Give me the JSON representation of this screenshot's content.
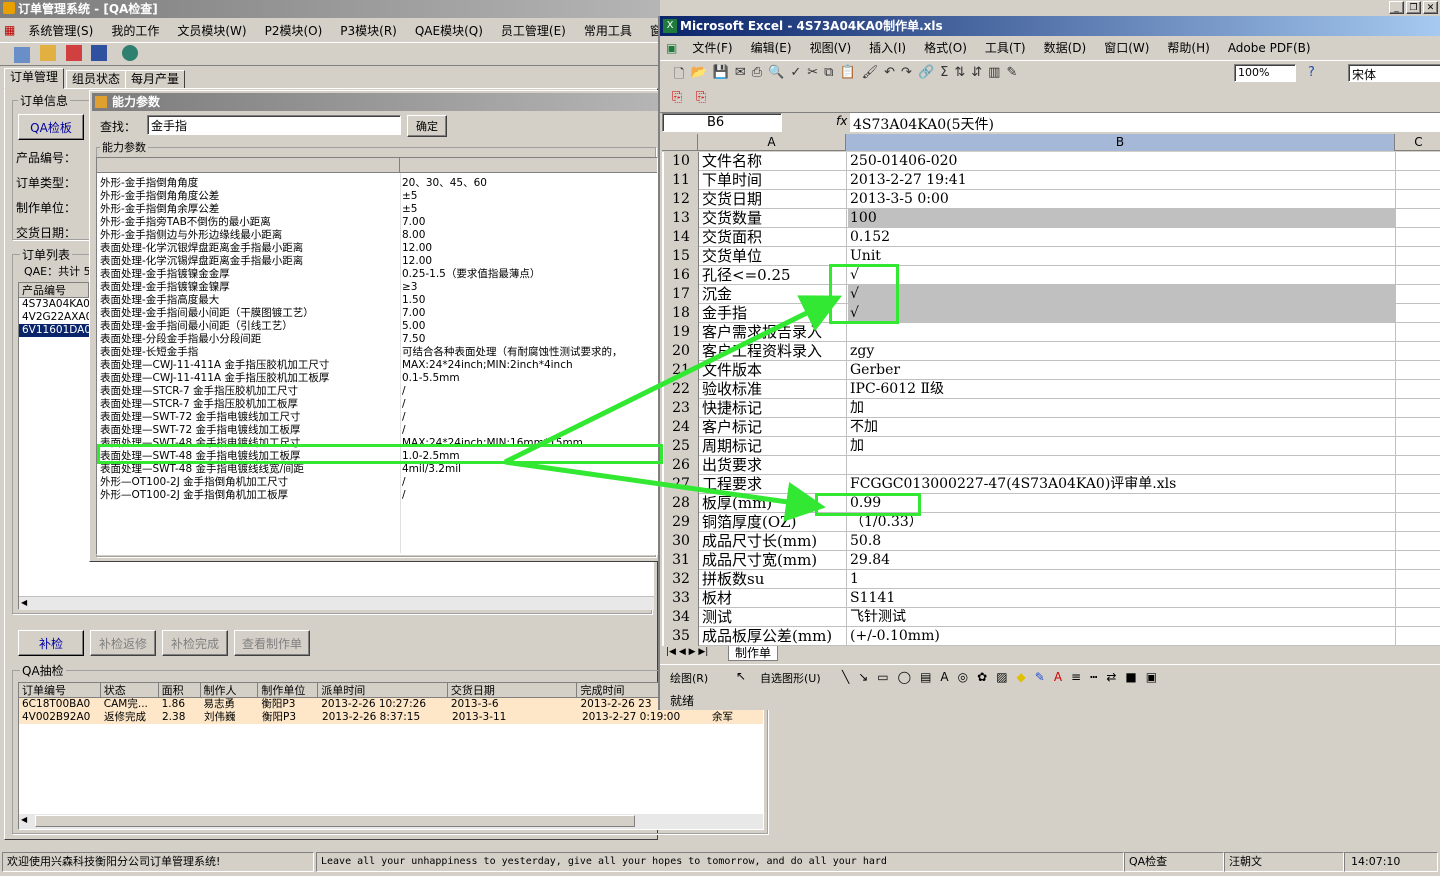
{
  "app": {
    "title": "订单管理系统 - [QA检查]",
    "menu": [
      "系统管理(S)",
      "我的工作",
      "文员模块(W)",
      "P2模块(O)",
      "P3模块(R)",
      "QAE模块(Q)",
      "员工管理(E)",
      "常用工具",
      "窗"
    ],
    "tabs": [
      "订单管理",
      "组员状态",
      "每月产量"
    ],
    "order_info": {
      "legend": "订单信息",
      "qa_button": "QA检板",
      "labels": [
        "产品编号：",
        "订单类型：",
        "制作单位：",
        "交货日期："
      ]
    },
    "order_list": {
      "legend": "订单列表",
      "qae_total": "QAE：共计 5",
      "header": "产品编号",
      "items": [
        "4S73A04KA0",
        "4V2G22AXA0",
        "6V11601DA0"
      ]
    },
    "buttons": {
      "recheck": "补检",
      "recheck_return": "补检返修",
      "recheck_done": "补检完成",
      "view_sheet": "查看制作单"
    },
    "qa_sample": {
      "legend": "QA抽检",
      "columns": [
        "订单编号",
        "状态",
        "面积",
        "制作人",
        "制作单位",
        "派单时间",
        "交货日期",
        "完成时间"
      ],
      "rows": [
        [
          "6C18T00BA0",
          "CAM完...",
          "1.86",
          "易志勇",
          "衡阳P3",
          "2013-2-26 10:27:26",
          "2013-3-6",
          "2013-2-26 23"
        ],
        [
          "4V002B92A0",
          "返修完成",
          "2.38",
          "刘伟巍",
          "衡阳P3",
          "2013-2-26 8:37:15",
          "2013-3-11",
          "2013-2-27 0:19:00"
        ]
      ],
      "extra": "余军"
    },
    "status": {
      "welcome": "欢迎使用兴森科技衡阳分公司订单管理系统!",
      "motto": "Leave all your unhappiness to yesterday, give all your hopes to tomorrow, and do all your hard",
      "module": "QA检查",
      "user": "汪朝文",
      "time": "14:07:10"
    }
  },
  "dialog": {
    "title": "能力参数",
    "search_label": "查找：",
    "search_value": "金手指",
    "ok_label": "确定",
    "group_label": "能力参数",
    "params": [
      [
        "外形-金手指倒角角度",
        "20、30、45、60"
      ],
      [
        "外形-金手指倒角角度公差",
        "±5"
      ],
      [
        "外形-金手指倒角余厚公差",
        "±5"
      ],
      [
        "外形-金手指旁TAB不倒伤的最小距离",
        "7.00"
      ],
      [
        "外形-金手指侧边与外形边缘线最小距离",
        "8.00"
      ],
      [
        "表面处理-化学沉银焊盘距离金手指最小距离",
        "12.00"
      ],
      [
        "表面处理-化学沉锡焊盘距离金手指最小距离",
        "12.00"
      ],
      [
        "表面处理-金手指镀镍金金厚",
        "0.25-1.5（要求值指最薄点）"
      ],
      [
        "表面处理-金手指镀镍金镍厚",
        "≥3"
      ],
      [
        "表面处理-金手指高度最大",
        "1.50"
      ],
      [
        "表面处理-金手指间最小间距（干膜图镀工艺）",
        "7.00"
      ],
      [
        "表面处理-金手指间最小间距（引线工艺）",
        "5.00"
      ],
      [
        "表面处理-分段金手指最小分段间距",
        "7.50"
      ],
      [
        "表面处理-长短金手指",
        "可结合各种表面处理（有耐腐蚀性测试要求的，"
      ],
      [
        "表面处理—CWJ-11-411A 金手指压胶机加工尺寸",
        "MAX:24*24inch;MIN:2inch*4inch"
      ],
      [
        "表面处理—CWJ-11-411A 金手指压胶机加工板厚",
        "0.1-5.5mm"
      ],
      [
        "表面处理—STCR-7 金手指压胶机加工尺寸",
        "/"
      ],
      [
        "表面处理—STCR-7 金手指压胶机加工板厚",
        "/"
      ],
      [
        "表面处理—SWT-72 金手指电镀线加工尺寸",
        "/"
      ],
      [
        "表面处理—SWT-72 金手指电镀线加工板厚",
        "/"
      ],
      [
        "表面处理—SWT-48 金手指电镀线加工尺寸",
        "MAX:24*24inch;MIN:16mm*15mm"
      ],
      [
        "表面处理—SWT-48 金手指电镀线加工板厚",
        "1.0-2.5mm"
      ],
      [
        "表面处理—SWT-48 金手指电镀线线宽/间距",
        "4mil/3.2mil"
      ],
      [
        "外形—OT100-2J 金手指倒角机加工尺寸",
        "/"
      ],
      [
        "外形—OT100-2J 金手指倒角机加工板厚",
        "/"
      ]
    ]
  },
  "excel": {
    "title": "Microsoft Excel - 4S73A04KA0制作单.xls",
    "menu": [
      "文件(F)",
      "编辑(E)",
      "视图(V)",
      "插入(I)",
      "格式(O)",
      "工具(T)",
      "数据(D)",
      "窗口(W)",
      "帮助(H)",
      "Adobe PDF(B)"
    ],
    "zoom": "100%",
    "font": "宋体",
    "name_box": "B6",
    "formula": "4S73A04KA0(5天件)",
    "col_headers": [
      "A",
      "B",
      "C"
    ],
    "rows": [
      {
        "n": "10",
        "a": "文件名称",
        "b": "250-01406-020"
      },
      {
        "n": "11",
        "a": "下单时间",
        "b": "2013-2-27 19:41"
      },
      {
        "n": "12",
        "a": "交货日期",
        "b": "2013-3-5 0:00"
      },
      {
        "n": "13",
        "a": "交货数量",
        "b": "100"
      },
      {
        "n": "14",
        "a": "交货面积",
        "b": "0.152"
      },
      {
        "n": "15",
        "a": "交货单位",
        "b": "Unit"
      },
      {
        "n": "16",
        "a": "孔径<=0.25",
        "b": "√"
      },
      {
        "n": "17",
        "a": "沉金",
        "b": "√"
      },
      {
        "n": "18",
        "a": "金手指",
        "b": "√"
      },
      {
        "n": "19",
        "a": "客户需求报告录入",
        "b": ""
      },
      {
        "n": "20",
        "a": "客户工程资料录入",
        "b": "zgy"
      },
      {
        "n": "21",
        "a": "文件版本",
        "b": "Gerber"
      },
      {
        "n": "22",
        "a": "验收标准",
        "b": "IPC-6012 Ⅱ级"
      },
      {
        "n": "23",
        "a": "快捷标记",
        "b": "加"
      },
      {
        "n": "24",
        "a": "客户标记",
        "b": "不加"
      },
      {
        "n": "25",
        "a": "周期标记",
        "b": "加"
      },
      {
        "n": "26",
        "a": "出货要求",
        "b": ""
      },
      {
        "n": "27",
        "a": "工程要求",
        "b": "FCGGC013000227-47(4S73A04KA0)评审单.xls"
      },
      {
        "n": "28",
        "a": "板厚(mm)",
        "b": "0.99"
      },
      {
        "n": "29",
        "a": "铜箔厚度(OZ)",
        "b": "（1/0.33）"
      },
      {
        "n": "30",
        "a": "成品尺寸长(mm)",
        "b": "50.8"
      },
      {
        "n": "31",
        "a": "成品尺寸宽(mm)",
        "b": "29.84"
      },
      {
        "n": "32",
        "a": "拼板数su",
        "b": "1"
      },
      {
        "n": "33",
        "a": "板材",
        "b": "S1141"
      },
      {
        "n": "34",
        "a": "测试",
        "b": "飞针测试"
      },
      {
        "n": "35",
        "a": "成品板厚公差(mm)",
        "b": "(+/-0.10mm)"
      }
    ],
    "sheet_tab": "制作单",
    "draw_label": "绘图(R)",
    "autoshape_label": "自选图形(U)",
    "status": "就绪"
  },
  "colors": {
    "highlight": "#33e833",
    "title_excel": "#0a246a"
  }
}
